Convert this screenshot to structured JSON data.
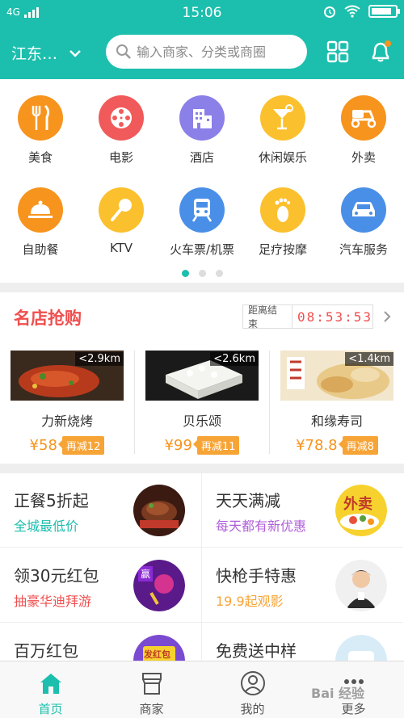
{
  "status_bar": {
    "network": "4G",
    "time": "15:06",
    "battery_level": 0.85
  },
  "header": {
    "city": "江东…",
    "search_placeholder": "输入商家、分类或商圈"
  },
  "categories": [
    {
      "label": "美食",
      "icon": "fork-knife-icon",
      "color": "#f7941d"
    },
    {
      "label": "电影",
      "icon": "film-reel-icon",
      "color": "#f15a5a"
    },
    {
      "label": "酒店",
      "icon": "building-icon",
      "color": "#8b7fe8"
    },
    {
      "label": "休闲娱乐",
      "icon": "cocktail-icon",
      "color": "#fbc02d"
    },
    {
      "label": "外卖",
      "icon": "scooter-icon",
      "color": "#f7941d"
    },
    {
      "label": "自助餐",
      "icon": "serving-dish-icon",
      "color": "#f7941d"
    },
    {
      "label": "KTV",
      "icon": "microphone-icon",
      "color": "#fbc02d"
    },
    {
      "label": "火车票/机票",
      "icon": "train-icon",
      "color": "#4a8fe7"
    },
    {
      "label": "足疗按摩",
      "icon": "foot-icon",
      "color": "#fbc02d"
    },
    {
      "label": "汽车服务",
      "icon": "car-icon",
      "color": "#4a8fe7"
    }
  ],
  "pager": {
    "pages": 3,
    "active": 0
  },
  "famous": {
    "title": "名店抢购",
    "countdown_label": "距离结束",
    "countdown_time": "08:53:53",
    "shops": [
      {
        "name": "力新烧烤",
        "distance": "<2.9km",
        "price": "¥58",
        "reduce": "再减12"
      },
      {
        "name": "贝乐颂",
        "distance": "<2.6km",
        "price": "¥99",
        "reduce": "再减11"
      },
      {
        "name": "和缘寿司",
        "distance": "<1.4km",
        "price": "¥78.8",
        "reduce": "再减8"
      }
    ]
  },
  "promos": [
    {
      "title": "正餐5折起",
      "subtitle": "全城最低价",
      "subtitle_color": "#1cbfad"
    },
    {
      "title": "天天满减",
      "subtitle": "每天都有新优惠",
      "subtitle_color": "#b05fd8",
      "badge": "外卖"
    },
    {
      "title": "领30元红包",
      "subtitle": "抽豪华迪拜游",
      "subtitle_color": "#f04e4e",
      "badge": "赢"
    },
    {
      "title": "快枪手特惠",
      "subtitle": "19.9起观影",
      "subtitle_color": "#f7a436"
    },
    {
      "title": "百万红包",
      "subtitle": "",
      "subtitle_color": "#333",
      "badge": "发红包"
    },
    {
      "title": "免费送中样",
      "subtitle": "",
      "subtitle_color": "#333"
    }
  ],
  "tabs": [
    {
      "label": "首页",
      "icon": "home-icon",
      "active": true
    },
    {
      "label": "商家",
      "icon": "shop-icon",
      "active": false
    },
    {
      "label": "我的",
      "icon": "user-icon",
      "active": false
    },
    {
      "label": "更多",
      "icon": "more-icon",
      "active": false
    }
  ],
  "watermark": "Bai 经验",
  "colors": {
    "brand": "#1cbfad",
    "accent_red": "#f04e4e",
    "accent_orange": "#f7941d"
  }
}
